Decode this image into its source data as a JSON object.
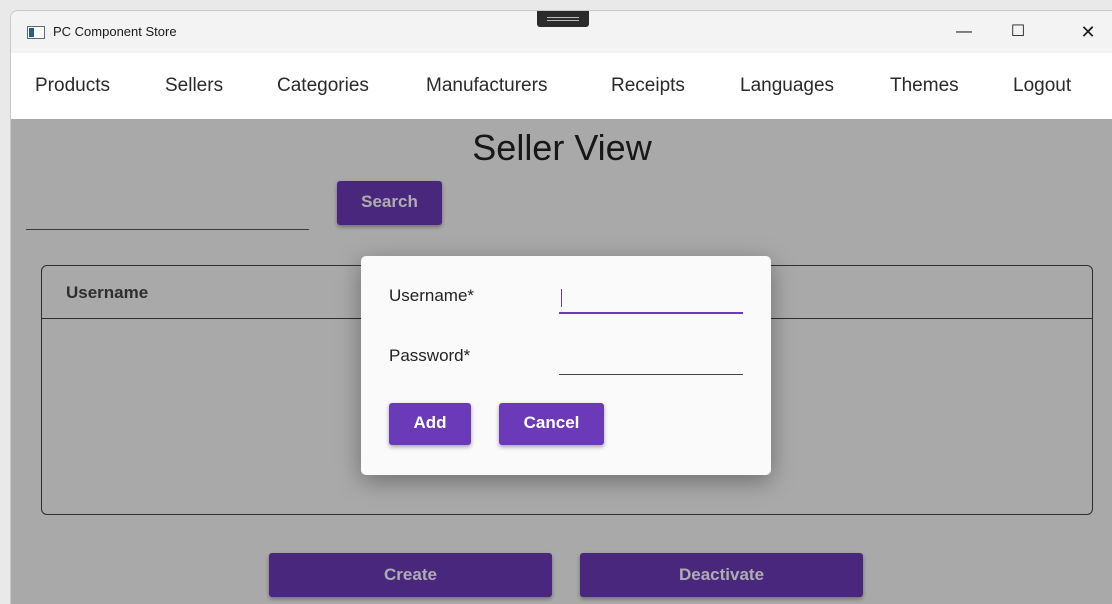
{
  "window": {
    "title": "PC Component Store",
    "controls": {
      "minimize": "—",
      "maximize": "☐",
      "close": "✕"
    }
  },
  "menu": {
    "items": [
      "Products",
      "Sellers",
      "Categories",
      "Manufacturers",
      "Receipts",
      "Languages",
      "Themes",
      "Logout"
    ]
  },
  "page": {
    "title": "Seller View",
    "search_value": "",
    "search_button": "Search",
    "table": {
      "columns": [
        "Username"
      ],
      "rows": []
    },
    "create_button": "Create",
    "deactivate_button": "Deactivate"
  },
  "dialog": {
    "username_label": "Username*",
    "username_value": "",
    "password_label": "Password*",
    "password_value": "",
    "add_button": "Add",
    "cancel_button": "Cancel"
  },
  "colors": {
    "accent": "#6a3ab8",
    "overlay": "rgba(0,0,0,0.32)"
  },
  "icons": [
    "app-icon",
    "drag-handle-icon",
    "minimize-icon",
    "maximize-icon",
    "close-icon"
  ]
}
